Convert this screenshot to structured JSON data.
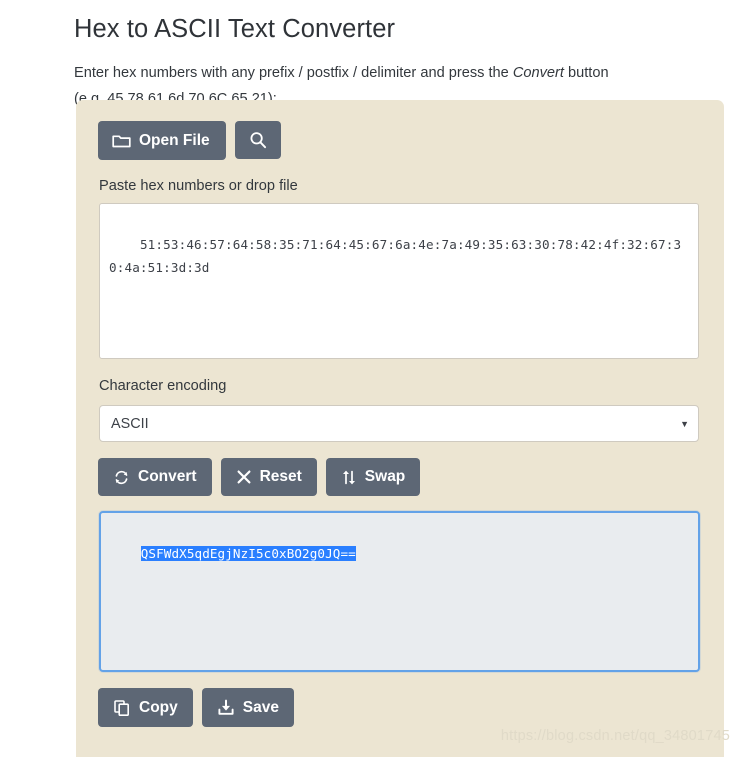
{
  "page": {
    "title": "Hex to ASCII Text Converter",
    "instructions_line1_a": "Enter hex numbers with any prefix / postfix / delimiter and press the ",
    "instructions_emphasis": "Convert",
    "instructions_line1_b": " button",
    "instructions_line2": "(e.g. 45 78 61 6d 70 6C 65 21):"
  },
  "toolbar": {
    "open_file_label": "Open File",
    "open_file_icon": "folder-icon",
    "search_icon": "search-icon"
  },
  "input": {
    "label": "Paste hex numbers or drop file",
    "value": "51:53:46:57:64:58:35:71:64:45:67:6a:4e:7a:49:35:63:30:78:42:4f:32:67:30:4a:51:3d:3d"
  },
  "encoding": {
    "label": "Character encoding",
    "selected": "ASCII",
    "caret_icon": "chevron-down-icon",
    "options": [
      "ASCII"
    ]
  },
  "actions": {
    "convert_label": "Convert",
    "convert_icon": "refresh-icon",
    "reset_label": "Reset",
    "reset_icon": "close-x-icon",
    "swap_label": "Swap",
    "swap_icon": "swap-arrows-icon"
  },
  "output": {
    "value": "QSFWdX5qdEgjNzI5c0xBO2g0JQ==",
    "selected": true
  },
  "bottom_actions": {
    "copy_label": "Copy",
    "copy_icon": "copy-icon",
    "save_label": "Save",
    "save_icon": "download-icon"
  },
  "watermark": {
    "text": "https://blog.csdn.net/qq_34801745"
  },
  "colors": {
    "panel_bg": "#ece5d2",
    "button_bg": "#5d6775",
    "focus_border": "#63a2e8",
    "selection_bg": "#2a7fff",
    "page_bg": "#ffffff"
  }
}
